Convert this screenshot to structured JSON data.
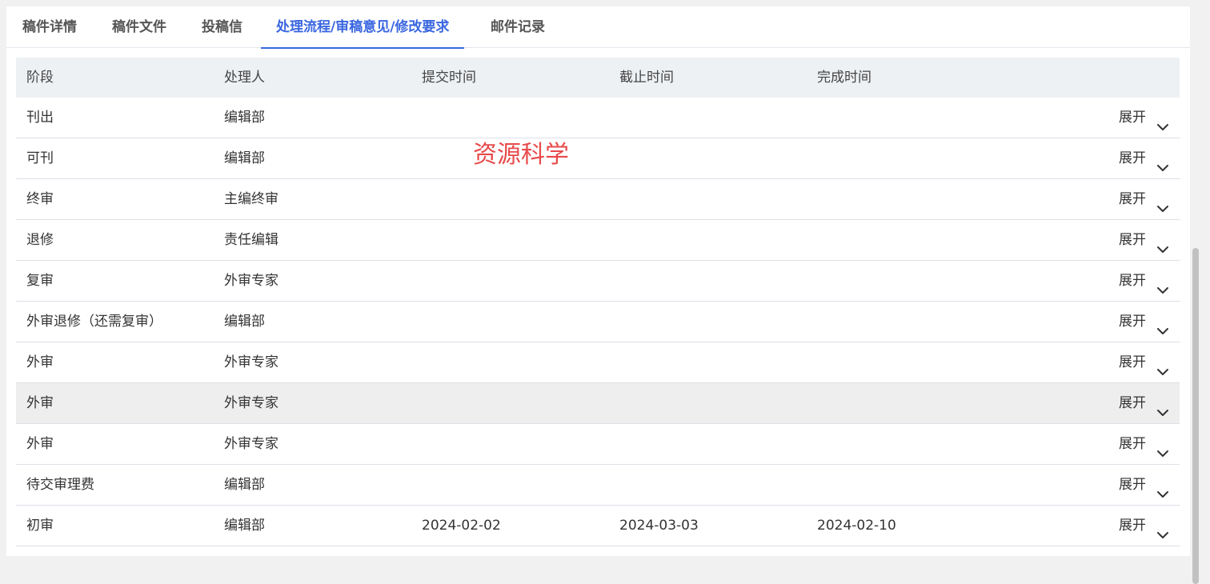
{
  "tabs": [
    {
      "label": "稿件详情",
      "active": false
    },
    {
      "label": "稿件文件",
      "active": false
    },
    {
      "label": "投稿信",
      "active": false
    },
    {
      "label": "处理流程/审稿意见/修改要求",
      "active": true
    },
    {
      "label": "邮件记录",
      "active": false
    }
  ],
  "table": {
    "headers": [
      "阶段",
      "处理人",
      "提交时间",
      "截止时间",
      "完成时间"
    ],
    "expand_label": "展开",
    "rows": [
      {
        "stage": "刊出",
        "handler": "编辑部",
        "submitted": "",
        "deadline": "",
        "completed": ""
      },
      {
        "stage": "可刊",
        "handler": "编辑部",
        "submitted": "",
        "deadline": "",
        "completed": ""
      },
      {
        "stage": "终审",
        "handler": "主编终审",
        "submitted": "",
        "deadline": "",
        "completed": ""
      },
      {
        "stage": "退修",
        "handler": "责任编辑",
        "submitted": "",
        "deadline": "",
        "completed": ""
      },
      {
        "stage": "复审",
        "handler": "外审专家",
        "submitted": "",
        "deadline": "",
        "completed": ""
      },
      {
        "stage": "外审退修（还需复审）",
        "handler": "编辑部",
        "submitted": "",
        "deadline": "",
        "completed": ""
      },
      {
        "stage": "外审",
        "handler": "外审专家",
        "submitted": "",
        "deadline": "",
        "completed": ""
      },
      {
        "stage": "外审",
        "handler": "外审专家",
        "submitted": "",
        "deadline": "",
        "completed": ""
      },
      {
        "stage": "外审",
        "handler": "外审专家",
        "submitted": "",
        "deadline": "",
        "completed": ""
      },
      {
        "stage": "待交审理费",
        "handler": "编辑部",
        "submitted": "",
        "deadline": "",
        "completed": ""
      },
      {
        "stage": "初审",
        "handler": "编辑部",
        "submitted": "2024-02-02",
        "deadline": "2024-03-03",
        "completed": "2024-02-10"
      }
    ]
  },
  "watermark": "资源科学",
  "colors": {
    "accent": "#3a66e0",
    "watermark": "#e84a4a",
    "header_bg": "#eef1f4",
    "hover_row_bg": "#eeeeee"
  },
  "icons": {
    "expand": "chevron-down-icon"
  }
}
